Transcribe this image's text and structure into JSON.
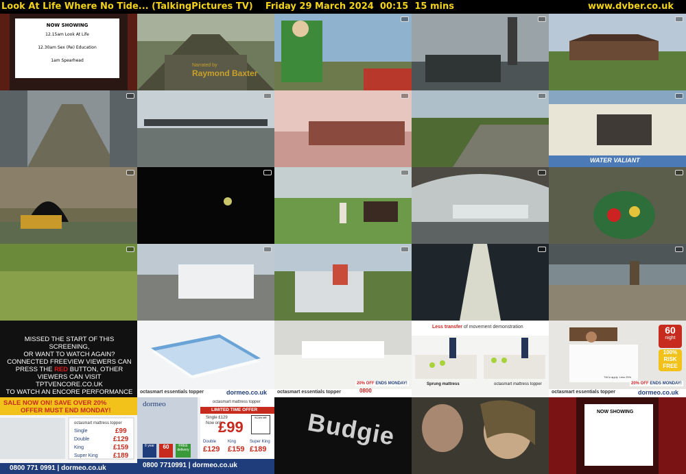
{
  "header": {
    "title": "Look At Life Where No Tide... (TalkingPictures TV)",
    "date": "Friday 29 March 2024",
    "time": "00:15",
    "duration": "15 mins",
    "site": "www.dvber.co.uk"
  },
  "colors": {
    "accent": "#f2d21b",
    "background": "#000000"
  },
  "thumbs": {
    "now_showing": {
      "heading": "NOW SHOWING",
      "line1": "12.15am Look At Life",
      "line2": "12.30am Sex (Re) Education",
      "line3": "1am Spearhead"
    },
    "credit": {
      "line1": "Narrated by",
      "line2": "Raymond Baxter"
    },
    "boat_name": "WATER VALIANT",
    "missed": {
      "l1": "MISSED THE START OF THIS SCREENING,",
      "l2": "OR WANT TO WATCH AGAIN?",
      "l3": "CONNECTED FREEVIEW VIEWERS CAN",
      "l4a": "PRESS THE ",
      "l4red": "RED",
      "l4b": " BUTTON, OTHER",
      "l5": "VIEWERS CAN VISIT TPTVENCORE.CO.UK",
      "l6": "TO WATCH AN ENCORE PERFORMANCE"
    },
    "ad": {
      "brand": "dormeo",
      "site": "dormeo.co.uk",
      "product": "octasmart essentials topper",
      "product2": "octasmart mattress topper",
      "less_transfer_bold": "Less transfer",
      "less_transfer_rest": "of movement demonstration",
      "sprung": "Sprung mattress",
      "offer": "20% OFF",
      "ends": "ENDS MONDAY!",
      "phone_short": "0800",
      "night_num": "60",
      "night_txt": "night",
      "risk": "100%",
      "risk2": "RISK",
      "risk3": "FREE",
      "tcs": "T&Cs apply. Less 25%",
      "sale1": "SALE NOW ON! SAVE OVER 20%",
      "sale2": "OFFER MUST END MONDAY!",
      "phone": "0800 771 0991",
      "phone2": "0800 7710991",
      "limited": "LIMITED TIME OFFER",
      "single": "Single",
      "double": "Double",
      "king": "King",
      "superking": "Super King",
      "p_single": "£99",
      "p_double": "£129",
      "p_king": "£159",
      "p_superking": "£189",
      "now_only": "Now only",
      "big_price": "£99",
      "single_was": "Single £129",
      "scan": "SCAN ME",
      "year": "8 year",
      "free": "FREE",
      "delivery": "delivery"
    },
    "logo_text": "Budgie",
    "now_showing_small": "NOW SHOWING"
  }
}
